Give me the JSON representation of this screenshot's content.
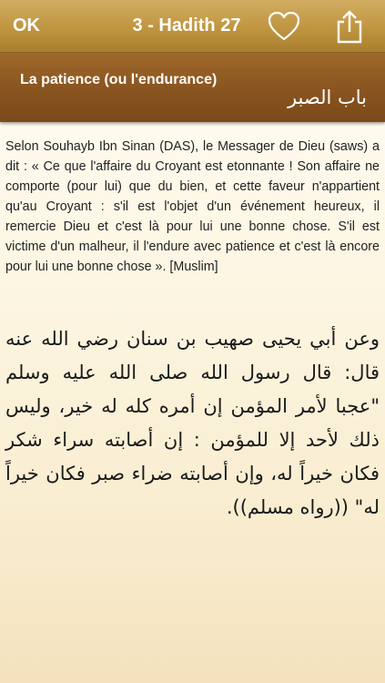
{
  "navbar": {
    "ok_label": "OK",
    "title": "3 - Hadith 27",
    "favorite_icon": "heart-icon",
    "share_icon": "share-icon"
  },
  "chapter": {
    "title_fr": "La patience (ou l'endurance)",
    "title_ar": "باب الصبر"
  },
  "hadith": {
    "text_fr": "Selon Souhayb Ibn Sinan (DAS), le Messager de Dieu (saws) a dit : « Ce que l'affaire du Croyant est etonnante ! Son affaire ne comporte (pour lui) que du bien, et cette faveur n'appartient qu'au Croyant : s'il est l'objet d'un événement heureux, il remercie Dieu et c'est là pour lui une bonne chose. S'il est victime d'un malheur, il l'endure avec patience et c'est là encore pour lui une bonne chose ». [Muslim]",
    "text_ar": "وعن أبي يحيى صهيب بن سنان رضي الله عنه قال: قال رسول الله صلى الله عليه وسلم \"عجبا لأمر المؤمن إن أمره كله له خير، وليس ذلك لأحد إلا للمؤمن : إن أصابته سراء شكر فكان خيراً له، وإن أصابته ضراء صبر فكان خيراً له\" ((رواه مسلم))."
  },
  "colors": {
    "navbar": "#bf9540",
    "chapter_bar": "#8a5520",
    "background": "#fdf6e3"
  }
}
